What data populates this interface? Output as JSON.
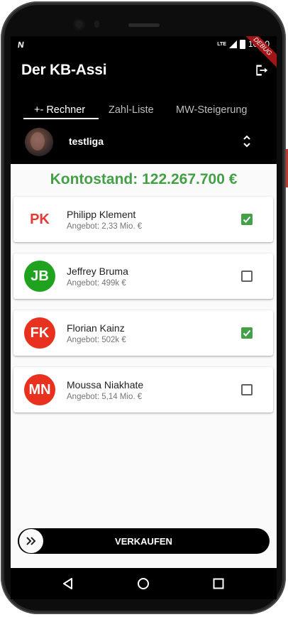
{
  "status_bar": {
    "carrier_glyph": "N",
    "network": "LTE",
    "time": "10:00",
    "debug_label": "DEBUG"
  },
  "app_bar": {
    "title": "Der KB-Assi",
    "logout_icon": "logout-icon"
  },
  "tabs": [
    {
      "label": "+- Rechner",
      "active": true
    },
    {
      "label": "Zahl-Liste",
      "active": false
    },
    {
      "label": "MW-Steigerung",
      "active": false
    }
  ],
  "league": {
    "name": "testliga",
    "selector_icon": "unfold-icon"
  },
  "balance": {
    "text": "Kontostand: 122.267.700 €",
    "color": "#43a047"
  },
  "players": [
    {
      "initials": "PK",
      "name": "Philipp Klement",
      "offer": "Angebot: 2,33 Mio. €",
      "checked": true,
      "avatar_color": null,
      "initials_color": "#e53935"
    },
    {
      "initials": "JB",
      "name": "Jeffrey Bruma",
      "offer": "Angebot: 499k €",
      "checked": false,
      "avatar_color": "#1fa31f",
      "initials_color": "#ffffff"
    },
    {
      "initials": "FK",
      "name": "Florian Kainz",
      "offer": "Angebot: 502k €",
      "checked": true,
      "avatar_color": "#e8311f",
      "initials_color": "#ffffff"
    },
    {
      "initials": "MN",
      "name": "Moussa Niakhate",
      "offer": "Angebot: 5,14 Mio. €",
      "checked": false,
      "avatar_color": "#e8311f",
      "initials_color": "#ffffff"
    }
  ],
  "sell": {
    "label": "VERKAUFEN",
    "knob_icon": "double-chevron-right-icon"
  },
  "colors": {
    "accent_green": "#43a047",
    "app_bar": "#000000",
    "debug_ribbon": "#a31515"
  },
  "navigation": [
    "back-icon",
    "home-icon",
    "recents-icon"
  ]
}
